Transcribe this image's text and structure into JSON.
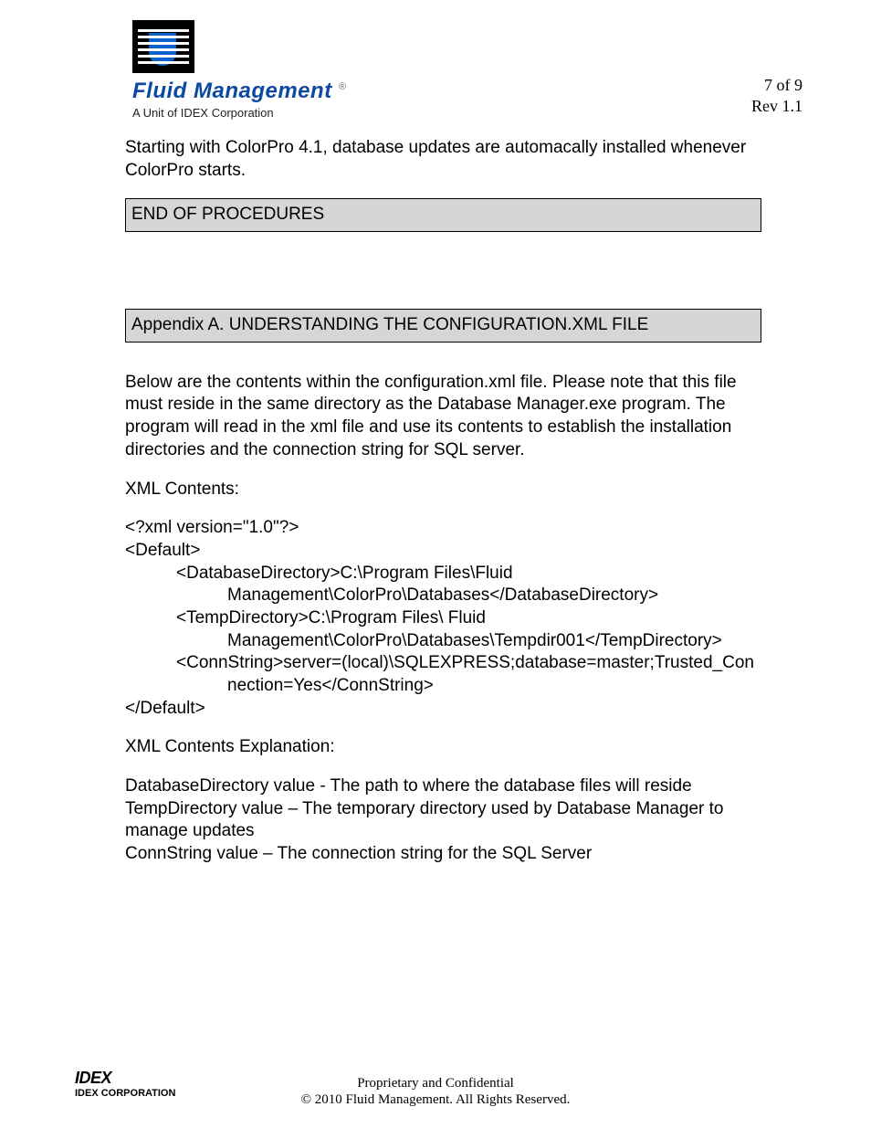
{
  "header": {
    "brand_name": "Fluid Management",
    "brand_suffix": "®",
    "subbrand": "A Unit of IDEX Corporation",
    "page_of": "7 of 9",
    "rev": "Rev 1.1"
  },
  "body": {
    "intro_para": "Starting with ColorPro 4.1, database updates are automacally installed whenever ColorPro starts.",
    "section_end": "END OF PROCEDURES",
    "section_appendix": "Appendix A.  UNDERSTANDING THE CONFIGURATION.XML FILE",
    "appendix_intro": "Below are the contents within the configuration.xml file. Please note that this file must reside in the same directory as the Database Manager.exe program. The program will read in the xml file and use its contents to establish the installation directories and the connection string for SQL server.",
    "xml_label": "XML Contents:",
    "xml": {
      "l1": "<?xml version=\"1.0\"?>",
      "l2": "<Default>",
      "l3": "<DatabaseDirectory>C:\\Program Files\\Fluid",
      "l4": "Management\\ColorPro\\Databases</DatabaseDirectory>",
      "l5": "<TempDirectory>C:\\Program Files\\ Fluid",
      "l6": "Management\\ColorPro\\Databases\\Tempdir001</TempDirectory>",
      "l7": "<ConnString>server=(local)\\SQLEXPRESS;database=master;Trusted_Con",
      "l8": "nection=Yes</ConnString>",
      "l9": "</Default>"
    },
    "explain_label": "XML Contents Explanation:",
    "explain1": "DatabaseDirectory value - The path to where the database files will reside",
    "explain2": "TempDirectory value – The temporary directory used by Database Manager to manage updates",
    "explain3": "ConnString value – The connection string for the SQL Server"
  },
  "footer": {
    "company_logo": "IDEX",
    "company_sub": "IDEX CORPORATION",
    "line1": "Proprietary and Confidential",
    "line2": "© 2010 Fluid Management. All Rights Reserved."
  }
}
